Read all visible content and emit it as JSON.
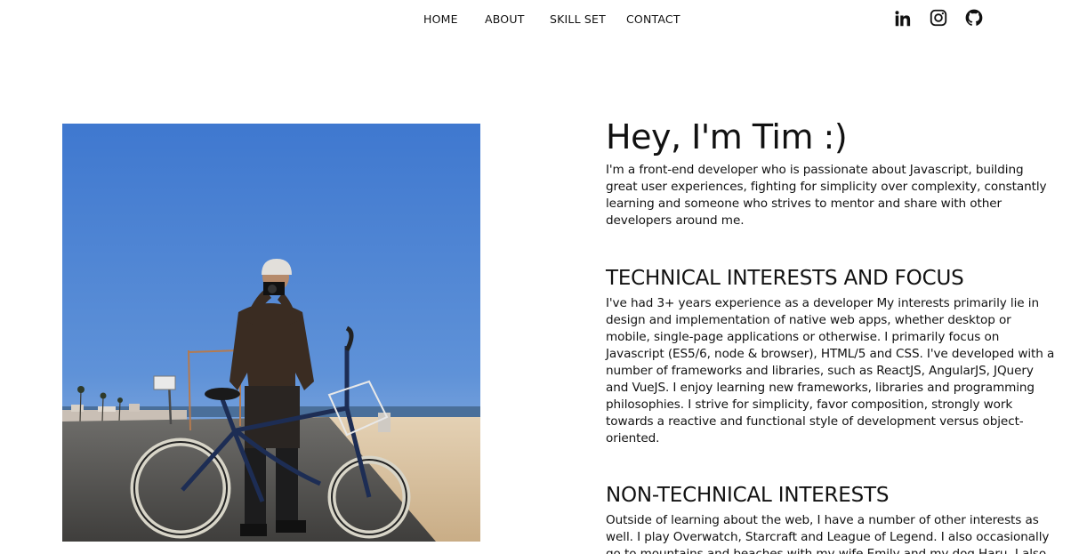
{
  "nav": {
    "links": [
      "HOME",
      "ABOUT",
      "SKILL SET",
      "CONTACT"
    ]
  },
  "social": {
    "icons": [
      "linkedin-icon",
      "instagram-icon",
      "github-icon"
    ]
  },
  "hero": {
    "title": "Hey, I'm Tim :)",
    "intro": "I'm a front-end developer who is passionate about Javascript, building great user experiences, fighting for simplicity over complexity, constantly learning and someone who strives to mentor and share with other developers around me."
  },
  "technical": {
    "heading": "TECHNICAL INTERESTS AND FOCUS",
    "body": "I've had 3+ years experience as a developer My interests primarily lie in design and implementation of native web apps, whether desktop or mobile, single-page applications or otherwise. I primarily focus on Javascript (ES5/6, node & browser), HTML/5 and CSS. I've developed with a number of frameworks and libraries, such as ReactJS, AngularJS, JQuery and VueJS. I enjoy learning new frameworks, libraries and programming philosophies. I strive for simplicity, favor composition, strongly work towards a reactive and functional style of development versus object-oriented."
  },
  "non_technical": {
    "heading": "NON-TECHNICAL INTERESTS",
    "body": "Outside of learning about the web, I have a number of other interests as well. I play Overwatch, Starcraft and League of Legend. I also occasionally go to mountains and beaches with my wife Emily and my dog Haru. I also enjoy"
  },
  "colors": {
    "text": "#111111",
    "sky": "#4a7fd0",
    "sand": "#d9c3a3"
  }
}
